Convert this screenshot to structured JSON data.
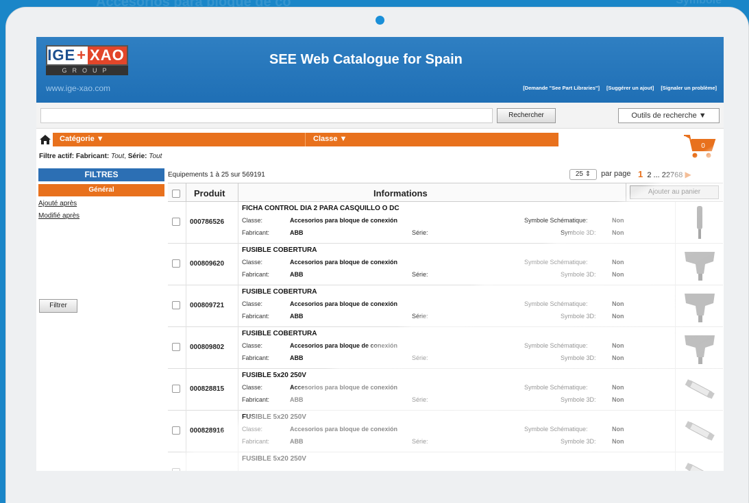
{
  "background_text": {
    "top": "Accesorios para bloque de co",
    "right": "Symbole"
  },
  "header": {
    "logo_top_left": "IGE",
    "logo_top_right": "XAO",
    "logo_bottom": "GROUP",
    "site_url": "www.ige-xao.com",
    "title": "SEE Web Catalogue for Spain",
    "links": [
      "[Demande \"See Part Libraries\"]",
      "[Suggérer un ajout]",
      "[Signaler un problème]"
    ]
  },
  "search": {
    "input_value": "",
    "search_button": "Rechercher",
    "tools_button": "Outils de recherche ▼"
  },
  "category_bar": {
    "categorie": "Catégorie ▼",
    "classe": "Classe ▼"
  },
  "cart": {
    "count": "0"
  },
  "active_filter": {
    "label": "Filtre actif:",
    "fabricant_label": "Fabricant:",
    "fabricant_value": "Tout",
    "serie_label": "Série:",
    "serie_value": "Tout"
  },
  "sidebar": {
    "filters_title": "FILTRES",
    "general_title": "Général",
    "links": [
      "Ajouté après",
      "Modifié après"
    ],
    "filter_button": "Filtrer"
  },
  "results": {
    "count_text": "Equipements 1 à 25 sur 569191",
    "per_page_value": "25 ⇕",
    "per_page_label": "par page",
    "pages": [
      "1",
      "2",
      "...",
      "22768"
    ],
    "next_arrow": "▶"
  },
  "table": {
    "headers": {
      "produit": "Produit",
      "informations": "Informations",
      "add_to_cart": "Ajouter au panier"
    },
    "labels": {
      "classe": "Classe:",
      "fabricant": "Fabricant:",
      "serie": "Série:",
      "symbole_schematique": "Symbole Schématique:",
      "symbole_3d": "Symbole 3D:"
    },
    "rows": [
      {
        "code": "000786526",
        "name": "FICHA CONTROL DIA 2 PARA CASQUILLO O DC",
        "classe": "Accesorios para bloque de conexión",
        "fabricant": "ABB",
        "serie": "",
        "schem": "Non",
        "sym3d": "Non",
        "thumb": "pin-icon"
      },
      {
        "code": "000809620",
        "name": "FUSIBLE COBERTURA",
        "classe": "Accesorios para bloque de conexión",
        "fabricant": "ABB",
        "serie": "",
        "schem": "Non",
        "sym3d": "Non",
        "thumb": "cover-icon"
      },
      {
        "code": "000809721",
        "name": "FUSIBLE COBERTURA",
        "classe": "Accesorios para bloque de conexión",
        "fabricant": "ABB",
        "serie": "",
        "schem": "Non",
        "sym3d": "Non",
        "thumb": "cover-icon"
      },
      {
        "code": "000809802",
        "name": "FUSIBLE COBERTURA",
        "classe": "Accesorios para bloque de conexión",
        "fabricant": "ABB",
        "serie": "",
        "schem": "Non",
        "sym3d": "Non",
        "thumb": "cover-icon"
      },
      {
        "code": "000828815",
        "name": "FUSIBLE 5x20 250V",
        "classe": "Accesorios para bloque de conexión",
        "fabricant": "ABB",
        "serie": "",
        "schem": "Non",
        "sym3d": "Non",
        "thumb": "fuse-icon"
      },
      {
        "code": "000828916",
        "name": "FUSIBLE 5x20 250V",
        "classe": "Accesorios para bloque de conexión",
        "fabricant": "ABB",
        "serie": "",
        "schem": "Non",
        "sym3d": "Non",
        "thumb": "fuse-icon"
      },
      {
        "code": "",
        "name": "FUSIBLE 5x20 250V",
        "classe": "",
        "fabricant": "",
        "serie": "",
        "schem": "",
        "sym3d": "",
        "thumb": "fuse-icon"
      }
    ]
  },
  "colors": {
    "background": "#1a86c8",
    "header_blue": "#2f7fc2",
    "accent_orange": "#e8711d",
    "filters_blue": "#2c6fb4"
  }
}
